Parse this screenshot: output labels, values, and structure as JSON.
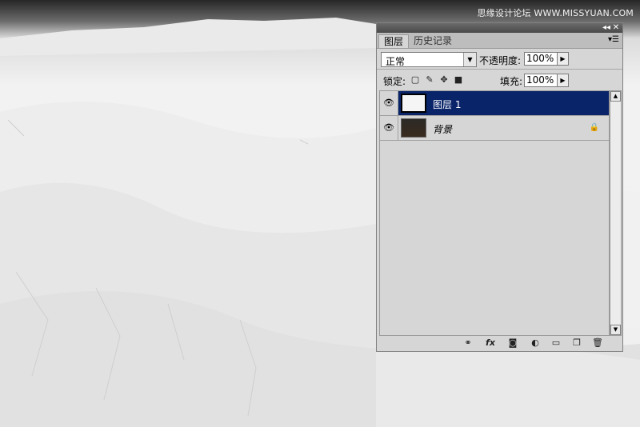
{
  "watermark": "思缘设计论坛 WWW.MISSYUAN.COM",
  "panel": {
    "tabs": [
      {
        "label": "图层",
        "active": true
      },
      {
        "label": "历史记录",
        "active": false
      }
    ],
    "blend_mode": "正常",
    "opacity_label": "不透明度:",
    "opacity_value": "100%",
    "lock_label": "锁定:",
    "fill_label": "填充:",
    "fill_value": "100%",
    "layers": [
      {
        "name": "图层 1",
        "selected": true
      },
      {
        "name": "背景",
        "selected": false,
        "locked": true
      }
    ]
  },
  "icons": {
    "collapse": "collapse-arrows-icon",
    "close": "close-icon",
    "panel_menu": "panel-menu-icon",
    "eye": "eye-icon",
    "link": "link-layers-icon",
    "fx": "fx",
    "mask": "add-mask-icon",
    "adjust": "adjustment-layer-icon",
    "group": "new-group-icon",
    "new_layer": "new-layer-icon",
    "trash": "trash-icon"
  }
}
